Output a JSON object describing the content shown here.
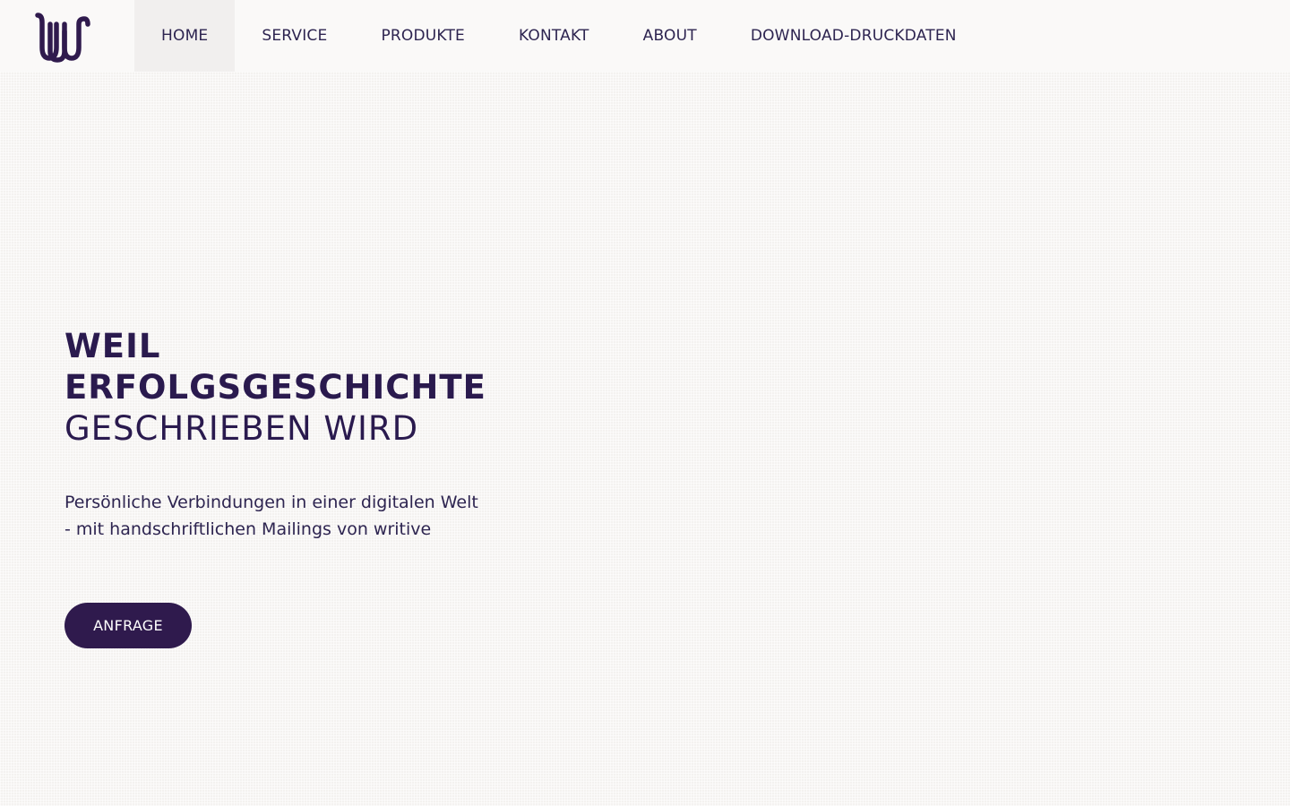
{
  "header": {
    "logo_alt": "writive",
    "nav": [
      {
        "label": "HOME"
      },
      {
        "label": "SERVICE"
      },
      {
        "label": "PRODUKTE"
      },
      {
        "label": "KONTAKT"
      },
      {
        "label": "ABOUT"
      },
      {
        "label": "DOWNLOAD-DRUCKDATEN"
      }
    ],
    "active_nav": "HOME"
  },
  "hero": {
    "title_line1": "WEIL",
    "title_line2": "ERFOLGSGESCHICHTE",
    "title_line3": "GESCHRIEBEN WIRD",
    "subtitle": "Persönliche Verbindungen in einer digitalen Welt - mit handschriftlichen Mailings von writive",
    "cta_label": "ANFRAGE"
  },
  "colors": {
    "brand": "#2f1a4d",
    "text": "#2a1f4a",
    "header_bg": "#faf9f8",
    "page_bg": "#f4f2f0"
  },
  "icons": {
    "logo": "writive-logo-icon"
  }
}
